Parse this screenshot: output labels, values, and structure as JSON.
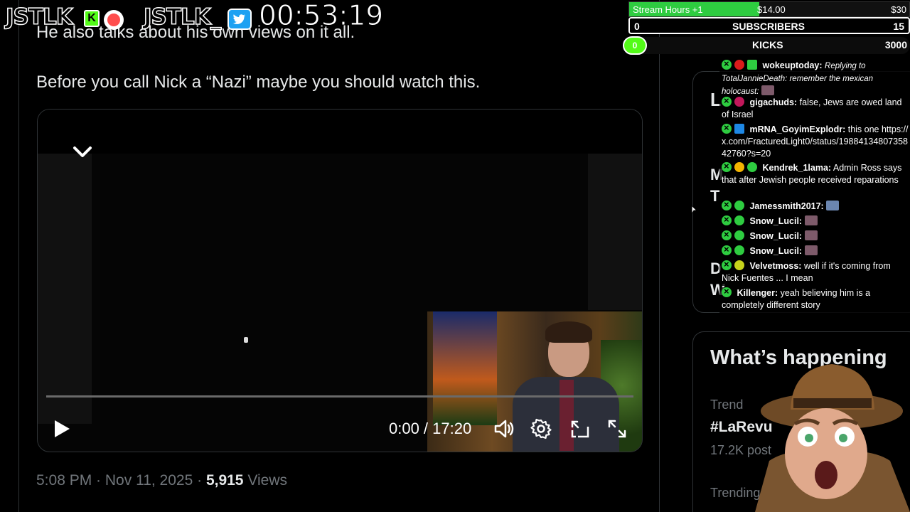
{
  "tweet": {
    "partial_line": "He also talks about his own views on it all.",
    "text": "Before you call Nick a “Nazi” maybe you should watch this.",
    "time": "5:08 PM",
    "date": "Nov 11, 2025",
    "views_count": "5,915",
    "views_label": "Views"
  },
  "video": {
    "time_display": "0:00 / 17:20",
    "progress": 0
  },
  "sidebar": {
    "card_letters": [
      "L",
      "M",
      "T",
      "D",
      "W"
    ],
    "happening_title": "What’s happening",
    "trend_label_1": "Trend",
    "trend_name_1": "#LaRevu",
    "trend_count_1": "17.2K post",
    "trend_label_2": "Trending",
    "rumble_url": "rumble.com/c/c-66"
  },
  "overlay": {
    "logo_left": "JSTLK",
    "logo_right": "JSTLK_",
    "kick_badge": "K",
    "stream_timer": "00:53:19",
    "goal_label": "Stream Hours +1",
    "goal_amount": "$14.00",
    "goal_target": "$30",
    "goal_progress": 0.465,
    "subscribers_label": "SUBSCRIBERS",
    "subscribers_current": "0",
    "subscribers_goal": "15",
    "kicks_label": "KICKS",
    "kicks_current": "0",
    "kicks_goal": "3000"
  },
  "chat": [
    {
      "user": "wokeuptoday:",
      "reply": "Replying to TotalJannieDeath: remember the mexican holocaust:",
      "text": ""
    },
    {
      "user": "gigachuds:",
      "text": "false, Jews are owed land of Israel"
    },
    {
      "user": "mRNA_GoyimExplodr:",
      "text": "this one https://x.com/FracturedLight0/status/1988413480735842760?s=20"
    },
    {
      "user": "Kendrek_1lama:",
      "text": "Admin Ross says that after Jewish people received reparations"
    },
    {
      "user": "Jamessmith2017:",
      "text": ""
    },
    {
      "user": "Snow_Lucil:",
      "text": ""
    },
    {
      "user": "Snow_Lucil:",
      "text": ""
    },
    {
      "user": "Snow_Lucil:",
      "text": ""
    },
    {
      "user": "Velvetmoss:",
      "text": "well if it's coming from Nick Fuentes ... I mean"
    },
    {
      "user": "Killenger:",
      "text": "yeah believing him is a completely different story"
    }
  ],
  "colors": {
    "accent_green": "#2ecc40",
    "kick_green": "#53fc18",
    "twitter_blue": "#1da1f2",
    "muted_text": "#71767b"
  },
  "icons": [
    "chevron-down-icon",
    "play-icon",
    "volume-icon",
    "settings-icon",
    "pip-icon",
    "fullscreen-icon",
    "twitter-icon",
    "kick-icon",
    "record-icon",
    "moderator-icon"
  ]
}
